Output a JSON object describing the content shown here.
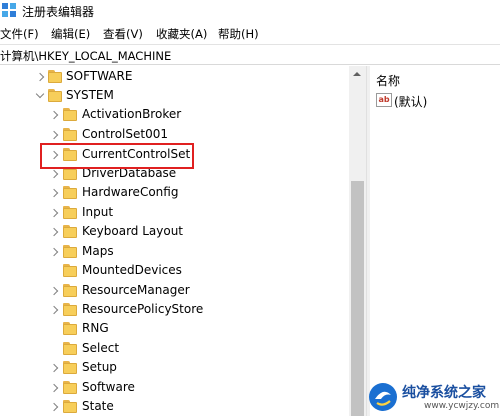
{
  "window": {
    "title": "注册表编辑器"
  },
  "menu": {
    "items": [
      {
        "label": "文件(F)"
      },
      {
        "label": "编辑(E)"
      },
      {
        "label": "查看(V)"
      },
      {
        "label": "收藏夹(A)"
      },
      {
        "label": "帮助(H)"
      }
    ]
  },
  "address": {
    "path": "计算机\\HKEY_LOCAL_MACHINE"
  },
  "tree": {
    "nodes": [
      {
        "label": "SOFTWARE",
        "expander": "collapsed"
      },
      {
        "label": "SYSTEM",
        "expander": "expanded"
      },
      {
        "label": "ActivationBroker",
        "expander": "collapsed"
      },
      {
        "label": "ControlSet001",
        "expander": "collapsed"
      },
      {
        "label": "CurrentControlSet",
        "expander": "collapsed",
        "highlighted": true
      },
      {
        "label": "DriverDatabase",
        "expander": "collapsed"
      },
      {
        "label": "HardwareConfig",
        "expander": "collapsed"
      },
      {
        "label": "Input",
        "expander": "collapsed"
      },
      {
        "label": "Keyboard Layout",
        "expander": "collapsed"
      },
      {
        "label": "Maps",
        "expander": "collapsed"
      },
      {
        "label": "MountedDevices",
        "expander": "none"
      },
      {
        "label": "ResourceManager",
        "expander": "collapsed"
      },
      {
        "label": "ResourcePolicyStore",
        "expander": "collapsed"
      },
      {
        "label": "RNG",
        "expander": "none"
      },
      {
        "label": "Select",
        "expander": "none"
      },
      {
        "label": "Setup",
        "expander": "collapsed"
      },
      {
        "label": "Software",
        "expander": "collapsed"
      },
      {
        "label": "State",
        "expander": "collapsed"
      }
    ]
  },
  "values_pane": {
    "column_name": "名称",
    "rows": [
      {
        "name": "(默认)",
        "icon": "string-value-icon"
      }
    ]
  },
  "watermark": {
    "title": "纯净系统之家",
    "url": "www.ycwjzy.com"
  },
  "colors": {
    "highlight_box": "#e02020",
    "folder": "#f7ce5a",
    "watermark_text": "#1a4fa0"
  }
}
